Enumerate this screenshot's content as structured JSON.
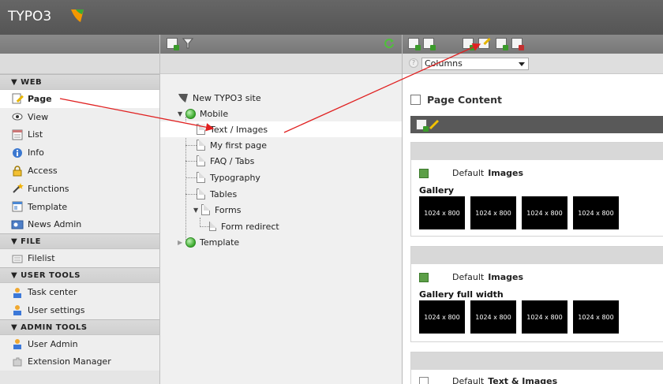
{
  "app": {
    "logo_text": "TYPO3"
  },
  "module_menu": {
    "groups": [
      {
        "title": "▼ WEB",
        "items": [
          {
            "label": "Page",
            "icon": "page-edit-icon"
          },
          {
            "label": "View",
            "icon": "eye-icon"
          },
          {
            "label": "List",
            "icon": "list-icon"
          },
          {
            "label": "Info",
            "icon": "info-icon"
          },
          {
            "label": "Access",
            "icon": "lock-icon"
          },
          {
            "label": "Functions",
            "icon": "wand-icon"
          },
          {
            "label": "Template",
            "icon": "template-icon"
          },
          {
            "label": "News Admin",
            "icon": "news-icon"
          }
        ]
      },
      {
        "title": "▼ FILE",
        "items": [
          {
            "label": "Filelist",
            "icon": "folder-icon"
          }
        ]
      },
      {
        "title": "▼ USER TOOLS",
        "items": [
          {
            "label": "Task center",
            "icon": "user-task-icon"
          },
          {
            "label": "User settings",
            "icon": "user-settings-icon"
          }
        ]
      },
      {
        "title": "▼ ADMIN TOOLS",
        "items": [
          {
            "label": "User Admin",
            "icon": "user-admin-icon"
          },
          {
            "label": "Extension Manager",
            "icon": "extension-icon"
          }
        ]
      }
    ]
  },
  "page_tree": {
    "root": "New TYPO3 site",
    "nodes": [
      {
        "label": "Mobile"
      },
      {
        "label": "Text / Images"
      },
      {
        "label": "My first page"
      },
      {
        "label": "FAQ / Tabs"
      },
      {
        "label": "Typography"
      },
      {
        "label": "Tables"
      },
      {
        "label": "Forms"
      },
      {
        "label": "Form redirect"
      },
      {
        "label": "Template"
      }
    ]
  },
  "content": {
    "columns_select": "Columns",
    "help_glyph": "?",
    "page_content_title": "Page Content",
    "elements": [
      {
        "type_prefix": "Default",
        "type": "Images",
        "label": "Gallery",
        "thumbs": [
          "1024 x 800",
          "1024 x 800",
          "1024 x 800",
          "1024 x 800"
        ]
      },
      {
        "type_prefix": "Default",
        "type": "Images",
        "label": "Gallery full width",
        "thumbs": [
          "1024 x 800",
          "1024 x 800",
          "1024 x 800",
          "1024 x 800"
        ]
      },
      {
        "type_prefix": "Default",
        "type": "Text & Images"
      }
    ]
  },
  "colors": {
    "topbar": "#5a5a5a",
    "annotation_arrow": "#e02020",
    "content_bar": "#595959"
  }
}
